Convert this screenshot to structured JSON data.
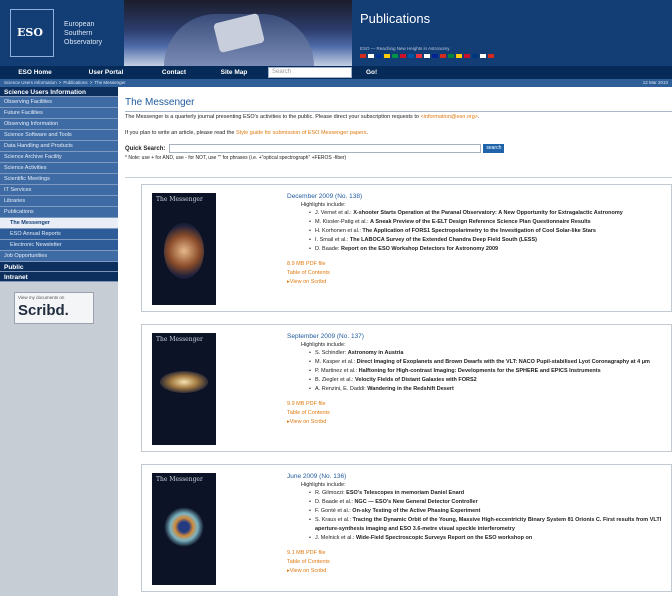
{
  "logo": {
    "line1": "European",
    "line2": "Southern",
    "line3": "Observatory",
    "mark": "ESO"
  },
  "banner": {
    "title": "Publications",
    "tagline": "ESO — Reaching New Heights in Astronomy"
  },
  "flag_colors": [
    "#d52b1e",
    "#ffffff",
    "#003399",
    "#ffcc00",
    "#009246",
    "#ce1126",
    "#0055a4",
    "#ef3340",
    "#ffffff",
    "#002395",
    "#d52b1e",
    "#00843d",
    "#ffcd00",
    "#c8102e",
    "#003580",
    "#ffffff",
    "#d52b1e"
  ],
  "nav": {
    "items": [
      "ESO Home",
      "User Portal",
      "Contact",
      "Site Map"
    ],
    "search_placeholder": "Search",
    "go": "Go!"
  },
  "breadcrumb": {
    "items": [
      "Science Users Information",
      "Publications",
      "The Messenger"
    ],
    "sep": ">",
    "date": "12 Mar 2010"
  },
  "sidebar": {
    "header": "Science Users Information",
    "items": [
      "Observing Facilities",
      "Future Facilities",
      "Observing Information",
      "Science Software and Tools",
      "Data Handling and Products",
      "Science Archive Facility",
      "Science Activities",
      "Scientific Meetings",
      "IT Services",
      "Libraries",
      "Publications"
    ],
    "sub": [
      "The Messenger",
      "ESO Annual Reports",
      "Electronic Newsletter"
    ],
    "item_jobs": "Job Opportunities",
    "public": "Public",
    "intranet": "Intranet",
    "scribd_caption": "View my documents on",
    "scribd_logo": "Scribd."
  },
  "main": {
    "title": "The Messenger",
    "intro": "The Messenger is a quarterly journal presenting ESO's activities to the public. Please direct your subscription requests to ",
    "intro_email": "<information@eso.org>",
    "intro_end": ".",
    "intro2": "If you plan to write an article, please read the ",
    "intro2_link": "Style guide for submission of ESO Messenger papers",
    "intro2_end": ".",
    "quick_search_label": "Quick Search:",
    "search_button": "search",
    "note": "* Note: use + for AND, use - for NOT, use \"\" for phrases (i.e. +\"optical spectrograph\" +FEROS -fiber)"
  },
  "issues": [
    {
      "title": "December 2009 (No. 138)",
      "cover_title": "The Messenger",
      "highlights_label": "Highlights include:",
      "items": [
        {
          "a": "J. Vernet et al.: ",
          "t": "X-shooter Starts Operation at the Paranal Observatory: A New Opportunity for Extragalactic Astronomy"
        },
        {
          "a": "M. Kissler-Patig et al.: ",
          "t": "A Sneak Preview of the E-ELT Design Reference Science Plan Questionnaire Results"
        },
        {
          "a": "H. Korhonen et al.: ",
          "t": "The Application of FORS1 Spectropolarimetry to the Investigation of Cool Solar-like Stars"
        },
        {
          "a": "I. Smail et al.: ",
          "t": "The LABOCA Survey of the Extended Chandra Deep Field South (LESS)"
        },
        {
          "a": "D. Baade: ",
          "t": "Report on the ESO Workshop Detectors for Astronomy 2009"
        }
      ],
      "pdf": "8.9 MB PDF file",
      "toc": "Table of Contents",
      "scribd": "View on Scribd"
    },
    {
      "title": "September 2009 (No. 137)",
      "cover_title": "The Messenger",
      "highlights_label": "Highlights include:",
      "items": [
        {
          "a": "S. Schindler: ",
          "t": "Astronomy in Austria"
        },
        {
          "a": "M. Kasper et al.: ",
          "t": "Direct Imaging of Exoplanets and Brown Dwarfs with the VLT: NACO Pupil-stabilised Lyot Coronagraphy at 4 μm"
        },
        {
          "a": "P. Martinez et al.: ",
          "t": "Halftoning for High-contrast Imaging: Developments for the SPHERE and EPICS Instruments"
        },
        {
          "a": "B. Ziegler et al.: ",
          "t": "Velocity Fields of Distant Galaxies with FORS2"
        },
        {
          "a": "A. Renzini, E. Daddi: ",
          "t": "Wandering in the Redshift Desert"
        }
      ],
      "pdf": "9.9 MB PDF file",
      "toc": "Table of Contents",
      "scribd": "View on Scribd"
    },
    {
      "title": "June 2009 (No. 136)",
      "cover_title": "The Messenger",
      "highlights_label": "Highlights include:",
      "items": [
        {
          "a": "R. Gilmozzi: ",
          "t": "ESO's Telescopes in memoriam Daniel Enard"
        },
        {
          "a": "D. Baade et al.: ",
          "t": "NGC — ESO's New General Detector Controller"
        },
        {
          "a": "F. Gonté et al.: ",
          "t": "On-sky Testing of the Active Phasing Experiment"
        },
        {
          "a": "S. Kraus et al.: ",
          "t": "Tracing the Dynamic Orbit of the Young, Massive High-eccentricity Binary System θ1 Orionis C. First results from VLTI aperture-synthesis imaging and ESO 3.6-metre visual speckle interferometry"
        },
        {
          "a": "J. Melnick et al.: ",
          "t": "Wide-Field Spectroscopic Surveys Report on the ESO workshop on"
        }
      ],
      "pdf": "9.1 MB PDF file",
      "toc": "Table of Contents",
      "scribd": "View on Scribd"
    }
  ]
}
